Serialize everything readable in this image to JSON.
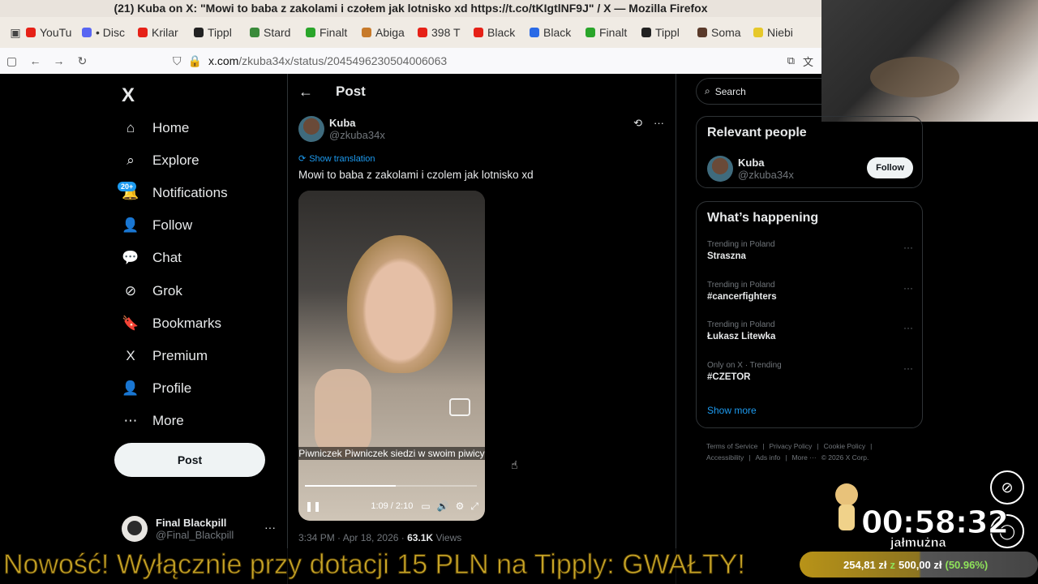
{
  "browser": {
    "window_title": "(21) Kuba on X: \"Mowi to baba z zakolami i czołem jak lotnisko xd https://t.co/tKIgtlNF9J\" / X — Mozilla Firefox",
    "tabs": [
      {
        "label": "YouTu",
        "color": "#e62117"
      },
      {
        "label": "• Disc",
        "color": "#5865f2"
      },
      {
        "label": "Krilar",
        "color": "#e62117"
      },
      {
        "label": "Tippl",
        "color": "#222222"
      },
      {
        "label": "Stard",
        "color": "#3a8a3a"
      },
      {
        "label": "Finalt",
        "color": "#2aa52a"
      },
      {
        "label": "Abiga",
        "color": "#c77a2a"
      },
      {
        "label": "398 T",
        "color": "#e62117"
      },
      {
        "label": "Black",
        "color": "#e62117"
      },
      {
        "label": "Black",
        "color": "#2a6ae6"
      },
      {
        "label": "Finalt",
        "color": "#2aa52a"
      },
      {
        "label": "Tippl",
        "color": "#222222"
      },
      {
        "label": "Soma",
        "color": "#5a3a2a"
      },
      {
        "label": "Niebi",
        "color": "#e6c82a"
      }
    ],
    "url_host": "x.com",
    "url_path": "/zkuba34x/status/2045496230504006063"
  },
  "nav": {
    "logo": "X",
    "items": [
      {
        "label": "Home",
        "icon": "home-icon"
      },
      {
        "label": "Explore",
        "icon": "search-icon"
      },
      {
        "label": "Notifications",
        "icon": "bell-icon",
        "badge": "20+"
      },
      {
        "label": "Follow",
        "icon": "follow-icon"
      },
      {
        "label": "Chat",
        "icon": "chat-icon"
      },
      {
        "label": "Grok",
        "icon": "grok-icon"
      },
      {
        "label": "Bookmarks",
        "icon": "bookmark-icon"
      },
      {
        "label": "Premium",
        "icon": "x-premium-icon"
      },
      {
        "label": "Profile",
        "icon": "profile-icon"
      },
      {
        "label": "More",
        "icon": "more-circle-icon"
      }
    ],
    "post_button": "Post",
    "account": {
      "name": "Final Blackpill",
      "handle": "@Final_Blackpill"
    }
  },
  "post": {
    "header_title": "Post",
    "author_name": "Kuba",
    "author_handle": "@zkuba34x",
    "show_translation": "Show translation",
    "text": "Mowi to baba z zakolami i czolem jak lotnisko xd",
    "video": {
      "caption": "Piwniczek Piwniczek siedzi w swoim piwicy",
      "time": "1:09 / 2:10",
      "progress_fraction": 0.53
    },
    "timestamp": "3:34 PM · Apr 18, 2026 · ",
    "views_count": "63.1K",
    "views_label": " Views"
  },
  "sidebar": {
    "search_placeholder": "Search",
    "relevant_title": "Relevant people",
    "relevant_person": {
      "name": "Kuba",
      "handle": "@zkuba34x",
      "follow_label": "Follow"
    },
    "happening_title": "What’s happening",
    "trends": [
      {
        "category": "Trending in Poland",
        "name": "Straszna"
      },
      {
        "category": "Trending in Poland",
        "name": "#cancerfighters"
      },
      {
        "category": "Trending in Poland",
        "name": "Łukasz Litewka"
      },
      {
        "category": "Only on X · Trending",
        "name": "#CZETOR"
      }
    ],
    "show_more": "Show more",
    "footer_links": [
      "Terms of Service",
      "|",
      "Privacy Policy",
      "|",
      "Cookie Policy",
      "|",
      "Accessibility",
      "|",
      "Ads info",
      "|",
      "More ···",
      "© 2026 X Corp."
    ]
  },
  "overlay": {
    "timer": "00:58:32",
    "timer_label": "jałmużna",
    "ticker": "Nowość! Wyłącznie przy dotacji 15 PLN na Tipply: GWAŁTY!",
    "goal_current": "254,81 zł",
    "goal_separator": "z",
    "goal_target": "500,00 zł",
    "goal_percent": "(50.96%)"
  }
}
